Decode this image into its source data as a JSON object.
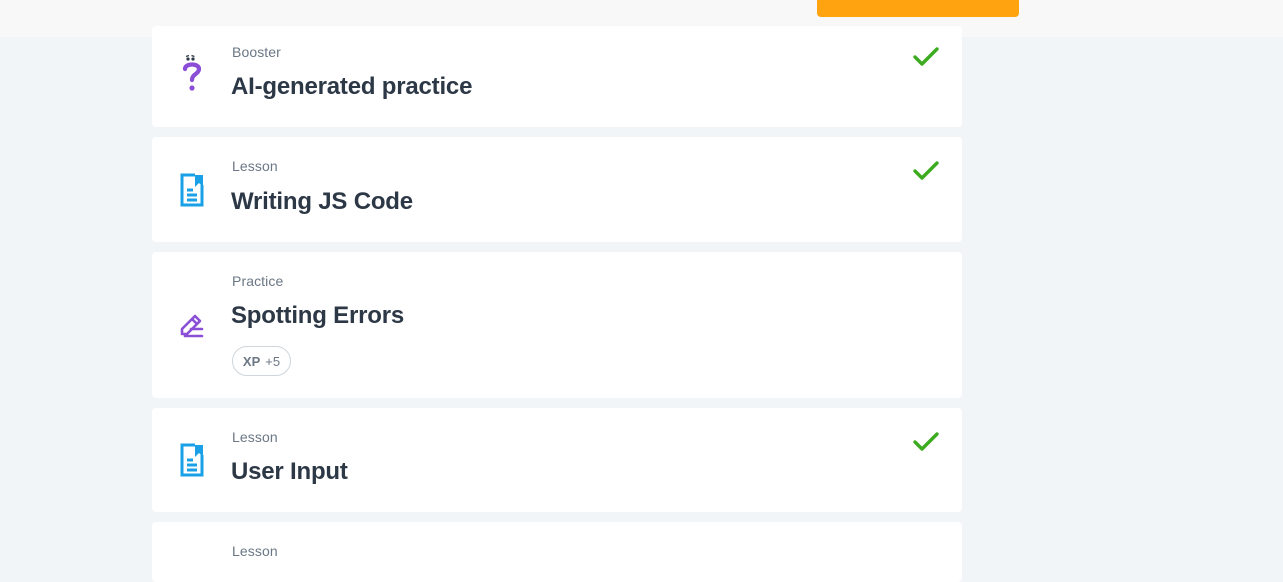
{
  "lessons": [
    {
      "kind": "Booster",
      "title": "AI-generated practice",
      "icon": "question-mark-icon",
      "completed": true
    },
    {
      "kind": "Lesson",
      "title": "Writing JS Code",
      "icon": "document-bookmark-icon",
      "completed": true
    },
    {
      "kind": "Practice",
      "title": "Spotting Errors",
      "icon": "pencil-edit-icon",
      "completed": false,
      "xp_label": "XP",
      "xp_value": "+5"
    },
    {
      "kind": "Lesson",
      "title": "User Input",
      "icon": "document-bookmark-icon",
      "completed": true
    },
    {
      "kind": "Lesson",
      "title": "",
      "icon": "",
      "completed": false
    }
  ],
  "colors": {
    "page_bg": "#f2f5f8",
    "card_bg": "#ffffff",
    "cta": "#ffa310",
    "check": "#3cab1f",
    "lesson_icon": "#1aa0e6",
    "practice_icon": "#8a4fd6"
  }
}
